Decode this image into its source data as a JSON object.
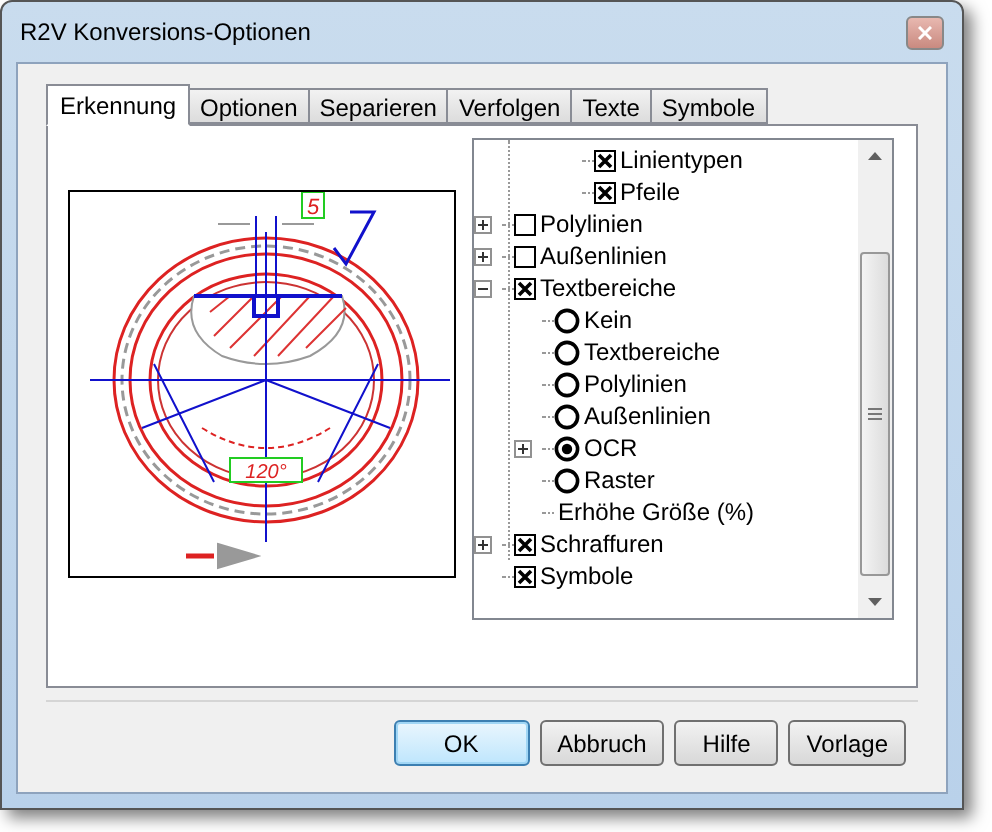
{
  "window": {
    "title": "R2V Konversions-Optionen"
  },
  "tabs": [
    {
      "label": "Erkennung",
      "selected": true
    },
    {
      "label": "Optionen",
      "selected": false
    },
    {
      "label": "Separieren",
      "selected": false
    },
    {
      "label": "Verfolgen",
      "selected": false
    },
    {
      "label": "Texte",
      "selected": false
    },
    {
      "label": "Symbole",
      "selected": false
    }
  ],
  "preview": {
    "dimension_labels": [
      "5",
      "120°"
    ]
  },
  "tree": {
    "scrolled_children": [
      {
        "kind": "checkbox",
        "label": "Linientypen",
        "checked": true
      },
      {
        "kind": "checkbox",
        "label": "Pfeile",
        "checked": true
      }
    ],
    "items": [
      {
        "kind": "checkbox",
        "label": "Polylinien",
        "checked": false,
        "expanded": false
      },
      {
        "kind": "checkbox",
        "label": "Außenlinien",
        "checked": false,
        "expanded": false
      },
      {
        "kind": "checkbox",
        "label": "Textbereiche",
        "checked": true,
        "expanded": true,
        "children": [
          {
            "kind": "radio",
            "label": "Kein",
            "selected": false
          },
          {
            "kind": "radio",
            "label": "Textbereiche",
            "selected": false
          },
          {
            "kind": "radio",
            "label": "Polylinien",
            "selected": false
          },
          {
            "kind": "radio",
            "label": "Außenlinien",
            "selected": false
          },
          {
            "kind": "radio",
            "label": "OCR",
            "selected": true,
            "expanded": false
          },
          {
            "kind": "radio",
            "label": "Raster",
            "selected": false
          },
          {
            "kind": "text",
            "label": "Erhöhe Größe (%)"
          }
        ]
      },
      {
        "kind": "checkbox",
        "label": "Schraffuren",
        "checked": true,
        "expanded": false
      },
      {
        "kind": "checkbox",
        "label": "Symbole",
        "checked": true
      }
    ]
  },
  "buttons": [
    {
      "label": "OK",
      "default": true
    },
    {
      "label": "Abbruch",
      "default": false
    },
    {
      "label": "Hilfe",
      "default": false
    },
    {
      "label": "Vorlage",
      "default": false
    }
  ]
}
